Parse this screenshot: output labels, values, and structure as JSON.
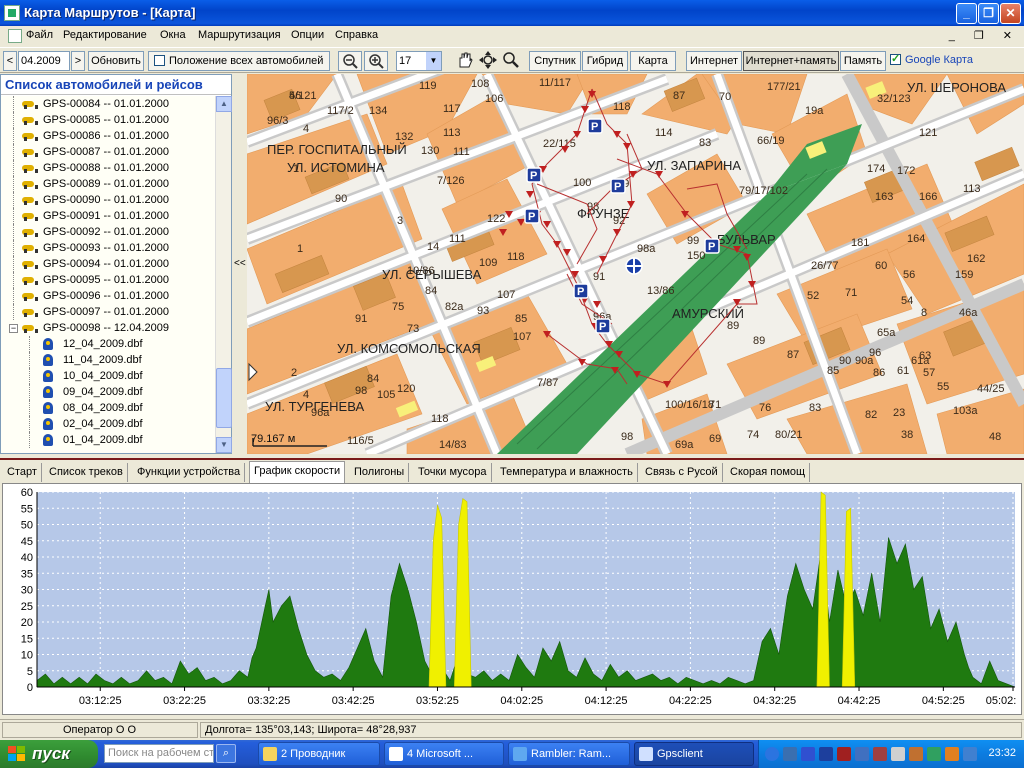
{
  "window": {
    "title": "Карта Маршрутов - [Карта]",
    "minimize_glyph": "_",
    "maximize_glyph": "❐",
    "close_glyph": "✕"
  },
  "menu": {
    "items": [
      "Файл",
      "Редактирование",
      "Окна",
      "Маршрутизация",
      "Опции",
      "Справка"
    ],
    "mdi_controls": "_ ❐ ✕"
  },
  "toolbar": {
    "prev": "<",
    "date_value": "04.2009",
    "next": ">",
    "refresh_label": "Обновить",
    "show_all_label": "Положение всех автомобилей",
    "show_all_checked": false,
    "zoom_out": "−",
    "zoom_in": "+",
    "zoom_level": "17",
    "satellite_label": "Спутник",
    "hybrid_label": "Гибрид",
    "map_label": "Карта",
    "internet_label": "Интернет",
    "internet_memory_label": "Интернет+память",
    "memory_label": "Память",
    "google_map_label": "Google Карта",
    "google_map_checked": true
  },
  "left_panel": {
    "header": "Список автомобилей и рейсов",
    "vehicles": [
      "GPS-00084 -- 01.01.2000",
      "GPS-00085 -- 01.01.2000",
      "GPS-00086 -- 01.01.2000",
      "GPS-00087 -- 01.01.2000",
      "GPS-00088 -- 01.01.2000",
      "GPS-00089 -- 01.01.2000",
      "GPS-00090 -- 01.01.2000",
      "GPS-00091 -- 01.01.2000",
      "GPS-00092 -- 01.01.2000",
      "GPS-00093 -- 01.01.2000",
      "GPS-00094 -- 01.01.2000",
      "GPS-00095 -- 01.01.2000",
      "GPS-00096 -- 01.01.2000",
      "GPS-00097 -- 01.01.2000",
      "GPS-00098 -- 12.04.2009"
    ],
    "files": [
      "12_04_2009.dbf",
      "11_04_2009.dbf",
      "10_04_2009.dbf",
      "09_04_2009.dbf",
      "08_04_2009.dbf",
      "02_04_2009.dbf",
      "01_04_2009.dbf"
    ],
    "splitter_glyph": "<<"
  },
  "map": {
    "streets": [
      "УЛ. ШЕРОНОВА",
      "ПЕР. ГОСПИТАЛЬНЫЙ",
      "УЛ. ИСТОМИНА",
      "УЛ. ЗАПАРИНА",
      "ФРУНЗЕ",
      "БУЛЬВАР",
      "УЛ. СЕРЫШЕВА",
      "АМУРСКИЙ",
      "УЛ. КОМСОМОЛЬСКАЯ",
      "УЛ. ТУРГЕНЕВА"
    ],
    "house_numbers": [
      "5/121",
      "117/2",
      "134",
      "96/3",
      "119",
      "108",
      "106",
      "11/117",
      "118",
      "87",
      "70",
      "177/21",
      "19а",
      "32/123",
      "132",
      "113",
      "117",
      "4",
      "1",
      "7/126",
      "22/115",
      "114",
      "83",
      "66/19",
      "121",
      "130",
      "111",
      "100",
      "109",
      "79/17/102",
      "174",
      "172",
      "90",
      "113",
      "3",
      "122",
      "98",
      "92",
      "163",
      "166",
      "14",
      "111",
      "118",
      "99",
      "181",
      "164",
      "162",
      "1",
      "10/86",
      "84",
      "109",
      "91",
      "98а",
      "150",
      "26/77",
      "60",
      "56",
      "159",
      "75",
      "82а",
      "93",
      "107",
      "13/86",
      "71",
      "54",
      "8",
      "91",
      "85",
      "96а",
      "52",
      "46а",
      "73",
      "89",
      "89",
      "96",
      "65а",
      "63",
      "107",
      "7/87",
      "87",
      "90",
      "90а",
      "61а",
      "2",
      "4",
      "85",
      "86",
      "61",
      "57",
      "55",
      "105",
      "120",
      "98",
      "84",
      "44/25",
      "96а",
      "118",
      "100/16/18",
      "71",
      "76",
      "83",
      "82",
      "23",
      "103а",
      "116/5",
      "14/83",
      "98",
      "69а",
      "69",
      "74",
      "80/21",
      "38",
      "48",
      "46"
    ],
    "scale_label": "79.167 м"
  },
  "tabs": [
    "Старт",
    "Список треков",
    "Функции устройства",
    "График скорости",
    "Полигоны",
    "Точки мусора",
    "Температура и влажность",
    "Связь с Русой",
    "Скорая помощ"
  ],
  "active_tab": "График скорости",
  "chart_data": {
    "type": "area",
    "title": "",
    "xlabel": "",
    "ylabel": "",
    "ylim": [
      0,
      60
    ],
    "y_ticks": [
      0,
      5,
      10,
      15,
      20,
      25,
      30,
      35,
      40,
      45,
      50,
      55,
      60
    ],
    "x_tick_labels": [
      "03:12:25",
      "03:22:25",
      "03:32:25",
      "03:42:25",
      "03:52:25",
      "04:02:25",
      "04:12:25",
      "04:22:25",
      "04:32:25",
      "04:42:25",
      "04:52:25",
      "05:02:"
    ],
    "x_range_minutes": [
      0,
      116
    ],
    "series": [
      {
        "color": "#1f7a10",
        "values_note": "speed over time, km/h",
        "points": [
          [
            0,
            2
          ],
          [
            1,
            4
          ],
          [
            2,
            1
          ],
          [
            3,
            3
          ],
          [
            4,
            1
          ],
          [
            5,
            3
          ],
          [
            6,
            1
          ],
          [
            7,
            4
          ],
          [
            8,
            2
          ],
          [
            9,
            1
          ],
          [
            10,
            3
          ],
          [
            11,
            1
          ],
          [
            12,
            2
          ],
          [
            13,
            5
          ],
          [
            14,
            2
          ],
          [
            15,
            3
          ],
          [
            16,
            1
          ],
          [
            17,
            8
          ],
          [
            18,
            4
          ],
          [
            19,
            6
          ],
          [
            20,
            2
          ],
          [
            21,
            3
          ],
          [
            22,
            1
          ],
          [
            23,
            2
          ],
          [
            24,
            5
          ],
          [
            25,
            3
          ],
          [
            25.5,
            9
          ],
          [
            26,
            12
          ],
          [
            27,
            24
          ],
          [
            27.5,
            30
          ],
          [
            28,
            20
          ],
          [
            29,
            25
          ],
          [
            30,
            28
          ],
          [
            31,
            18
          ],
          [
            32,
            10
          ],
          [
            33,
            5
          ],
          [
            34,
            3
          ],
          [
            35,
            4
          ],
          [
            36,
            2
          ],
          [
            37,
            6
          ],
          [
            38,
            12
          ],
          [
            39,
            18
          ],
          [
            40,
            8
          ],
          [
            41,
            3
          ],
          [
            42,
            28
          ],
          [
            43,
            38
          ],
          [
            44,
            30
          ],
          [
            45,
            20
          ],
          [
            46,
            8
          ],
          [
            47,
            3
          ],
          [
            48,
            6
          ],
          [
            49,
            2
          ],
          [
            50,
            10
          ],
          [
            51,
            4
          ],
          [
            52,
            3
          ],
          [
            53,
            5
          ],
          [
            54,
            2
          ],
          [
            55,
            4
          ],
          [
            56,
            2
          ],
          [
            57,
            10
          ],
          [
            58,
            6
          ],
          [
            59,
            3
          ],
          [
            60,
            12
          ],
          [
            61,
            8
          ],
          [
            62,
            14
          ],
          [
            63,
            5
          ],
          [
            64,
            3
          ],
          [
            65,
            9
          ],
          [
            66,
            4
          ],
          [
            67,
            2
          ],
          [
            68,
            7
          ],
          [
            69,
            3
          ],
          [
            70,
            5
          ],
          [
            71,
            2
          ],
          [
            72,
            3
          ],
          [
            73,
            4
          ],
          [
            74,
            2
          ],
          [
            75,
            3
          ],
          [
            76,
            1
          ],
          [
            77,
            3
          ],
          [
            78,
            2
          ],
          [
            79,
            1
          ],
          [
            80,
            2
          ],
          [
            81,
            1
          ],
          [
            82,
            3
          ],
          [
            83,
            2
          ],
          [
            84,
            1
          ],
          [
            85,
            2
          ],
          [
            86,
            14
          ],
          [
            87,
            18
          ],
          [
            88,
            10
          ],
          [
            89,
            28
          ],
          [
            90,
            38
          ],
          [
            91,
            30
          ],
          [
            92,
            24
          ],
          [
            93,
            42
          ],
          [
            94,
            20
          ],
          [
            95,
            36
          ],
          [
            96,
            25
          ],
          [
            97,
            30
          ],
          [
            98,
            22
          ],
          [
            99,
            35
          ],
          [
            100,
            20
          ],
          [
            101,
            46
          ],
          [
            102,
            38
          ],
          [
            103,
            44
          ],
          [
            104,
            30
          ],
          [
            105,
            34
          ],
          [
            106,
            18
          ],
          [
            107,
            24
          ],
          [
            108,
            14
          ],
          [
            109,
            20
          ],
          [
            110,
            10
          ],
          [
            110.5,
            6
          ],
          [
            111,
            3
          ],
          [
            112,
            1
          ],
          [
            113,
            8
          ],
          [
            114,
            2
          ],
          [
            115,
            1
          ],
          [
            116,
            0
          ]
        ]
      },
      {
        "color": "#f0f000",
        "values_note": "speed above limit",
        "points": [
          [
            46.5,
            0
          ],
          [
            47,
            45
          ],
          [
            47.5,
            56
          ],
          [
            48,
            52
          ],
          [
            48.5,
            0
          ],
          [
            49.5,
            0
          ],
          [
            50,
            50
          ],
          [
            50.5,
            58
          ],
          [
            51,
            57
          ],
          [
            51.5,
            0
          ],
          [
            92.5,
            0
          ],
          [
            93,
            60
          ],
          [
            93.5,
            59
          ],
          [
            94,
            0
          ],
          [
            95.5,
            0
          ],
          [
            96,
            54
          ],
          [
            96.5,
            55
          ],
          [
            97,
            0
          ]
        ]
      }
    ]
  },
  "status": {
    "operator": "Оператор О О",
    "coords": "Долгота= 135°03,143; Широта= 48°28,937"
  },
  "taskbar": {
    "start_label": "пуск",
    "search_placeholder": "Поиск на рабочем ст",
    "tasks": [
      "2 Проводник",
      "4 Microsoft ...",
      "Rambler: Ram...",
      "Gpsclient"
    ],
    "active_task": "Gpsclient",
    "clock": "23:32"
  }
}
